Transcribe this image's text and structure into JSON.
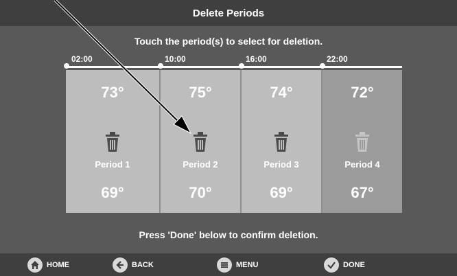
{
  "header": {
    "title": "Delete Periods"
  },
  "instructions": {
    "top": "Touch the period(s) to select for deletion.",
    "bottom": "Press 'Done' below to confirm deletion."
  },
  "timeline": {
    "times": [
      "02:00",
      "10:00",
      "16:00",
      "22:00"
    ]
  },
  "periods": [
    {
      "label": "Period 1",
      "high": "73°",
      "low": "69°",
      "selected": false
    },
    {
      "label": "Period 2",
      "high": "75°",
      "low": "70°",
      "selected": false
    },
    {
      "label": "Period 3",
      "high": "74°",
      "low": "69°",
      "selected": false
    },
    {
      "label": "Period 4",
      "high": "72°",
      "low": "67°",
      "selected": true
    }
  ],
  "nav": {
    "home": "HOME",
    "back": "BACK",
    "menu": "MENU",
    "done": "DONE"
  },
  "icons": [
    "home-icon",
    "back-arrow-icon",
    "menu-icon",
    "check-icon",
    "trash-icon"
  ],
  "colors": {
    "screen_bg": "#595959",
    "bar_bg": "#3f3f3f",
    "period_bg": "#bdbdbd",
    "period_selected_bg": "#9b9b9b"
  }
}
